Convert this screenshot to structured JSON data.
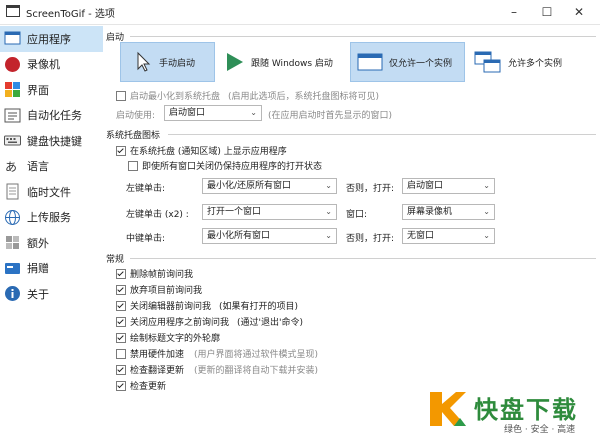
{
  "window": {
    "title": "ScreenToGif - 选项",
    "minimize": "–",
    "maximize": "☐",
    "close": "✕"
  },
  "sidebar": {
    "items": [
      {
        "label": "应用程序",
        "icon": "app-window-icon",
        "selected": true
      },
      {
        "label": "录像机",
        "icon": "record-icon"
      },
      {
        "label": "界面",
        "icon": "palette-icon"
      },
      {
        "label": "自动化任务",
        "icon": "tasks-icon"
      },
      {
        "label": "键盘快捷键",
        "icon": "keyboard-icon"
      },
      {
        "label": "语言",
        "icon": "language-icon"
      },
      {
        "label": "临时文件",
        "icon": "temp-files-icon"
      },
      {
        "label": "上传服务",
        "icon": "globe-icon"
      },
      {
        "label": "额外",
        "icon": "extras-icon"
      },
      {
        "label": "捐赠",
        "icon": "donate-icon"
      },
      {
        "label": "关于",
        "icon": "info-icon"
      }
    ]
  },
  "startup": {
    "header": "启动",
    "tiles": [
      "手动启动",
      "跟随 Windows 启动",
      "仅允许一个实例",
      "允许多个实例"
    ],
    "minimize_tray": "启动最小化到系统托盘",
    "minimize_tray_note": "(启用此选项后，系统托盘图标将可见)",
    "startup_use_label": "启动使用:",
    "startup_use_value": "启动窗口",
    "startup_use_note": "(在应用启动时首先显示的窗口)"
  },
  "tray": {
    "header": "系统托盘图标",
    "show_tray": "在系统托盘 (通知区域) 上显示应用程序",
    "keep_open": "即使所有窗口关闭仍保持应用程序的打开状态",
    "left_click": "左键单击:",
    "left_click_value": "最小化/还原所有窗口",
    "otherwise_open_1": "否则，打开:",
    "left_click_open": "启动窗口",
    "left_double": "左键单击 (x2) :",
    "left_double_value": "打开一个窗口",
    "window_label": "窗口:",
    "left_double_open": "屏幕录像机",
    "middle_click": "中键单击:",
    "middle_click_value": "最小化所有窗口",
    "otherwise_open_2": "否则，打开:",
    "middle_click_open": "无窗口"
  },
  "general": {
    "header": "常规",
    "items": [
      {
        "label": "删除帧前询问我",
        "checked": true
      },
      {
        "label": "放弃项目前询问我",
        "checked": true
      },
      {
        "label": "关闭编辑器前询问我",
        "note": "(如果有打开的项目)",
        "checked": true
      },
      {
        "label": "关闭应用程序之前询问我",
        "note": "(通过'退出'命令)",
        "checked": true
      },
      {
        "label": "绘制标题文字的外轮廓",
        "checked": true
      },
      {
        "label": "禁用硬件加速",
        "note": "(用户界面将通过软件模式呈现)",
        "checked": false
      },
      {
        "label": "检查翻译更新",
        "note": "(更新的翻译将自动下载并安装)",
        "checked": true
      },
      {
        "label": "检查更新",
        "checked": true
      }
    ]
  },
  "watermark": {
    "brand": "快盘下载",
    "tagline": "绿色 · 安全 · 高速"
  }
}
